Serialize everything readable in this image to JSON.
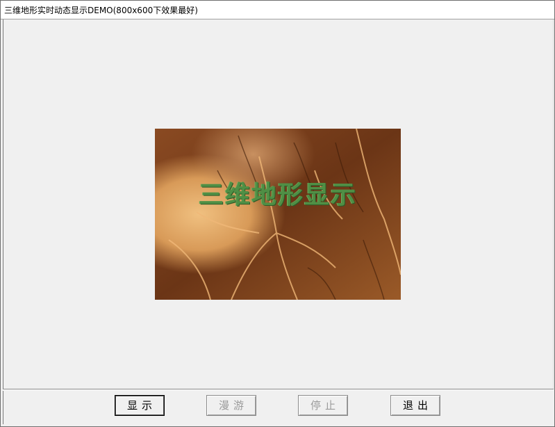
{
  "window": {
    "title": "三维地形实时动态显示DEMO(800x600下效果最好)"
  },
  "preview": {
    "caption": "三维地形显示",
    "image": "satellite-terrain-image"
  },
  "buttons": {
    "show": {
      "label": "显示",
      "enabled": true
    },
    "roam": {
      "label": "漫游",
      "enabled": false
    },
    "stop": {
      "label": "停止",
      "enabled": false
    },
    "exit": {
      "label": "退出",
      "enabled": true
    }
  },
  "colors": {
    "caption": "#4f8f45",
    "terrain_dark": "#5a2c10",
    "terrain_light": "#e8b070",
    "face": "#f0f0f0"
  }
}
